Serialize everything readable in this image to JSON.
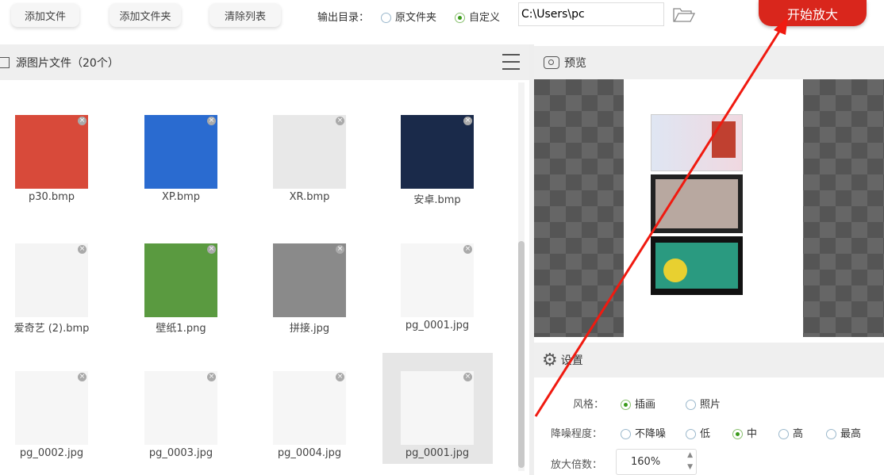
{
  "toolbar": {
    "add_file": "添加文件",
    "add_folder": "添加文件夹",
    "clear_list": "清除列表",
    "output_label": "输出目录：",
    "opt_source": "原文件夹",
    "opt_custom": "自定义",
    "output_path": "C:\\Users\\pc",
    "start": "开始放大"
  },
  "files": {
    "title": "源图片文件（20个）",
    "items": [
      {
        "name": "p30.bmp",
        "color": "#d84a3a"
      },
      {
        "name": "XP.bmp",
        "color": "#2a6bd0"
      },
      {
        "name": "XR.bmp",
        "color": "#e8e8e8"
      },
      {
        "name": "安卓.bmp",
        "color": "#1a2a4a"
      },
      {
        "name": "爱奇艺 (2).bmp",
        "color": "#f4f4f4"
      },
      {
        "name": "壁纸1.png",
        "color": "#5a9a40"
      },
      {
        "name": "拼接.jpg",
        "color": "#8a8a8a"
      },
      {
        "name": "pg_0001.jpg",
        "color": "#f6f6f6"
      },
      {
        "name": "pg_0002.jpg",
        "color": "#f6f6f6"
      },
      {
        "name": "pg_0003.jpg",
        "color": "#f6f6f6"
      },
      {
        "name": "pg_0004.jpg",
        "color": "#f6f6f6"
      },
      {
        "name": "pg_0001.jpg",
        "color": "#f6f6f6"
      }
    ]
  },
  "preview": {
    "title": "预览"
  },
  "settings": {
    "title": "设置",
    "style_label": "风格：",
    "style_opts": [
      "插画",
      "照片"
    ],
    "noise_label": "降噪程度：",
    "noise_opts": [
      "不降噪",
      "低",
      "中",
      "高",
      "最高"
    ],
    "scale_label": "放大倍数：",
    "scale_value": "160%"
  },
  "colors": {
    "accent": "#d9261c",
    "selected_radio": "#3a9a1a"
  }
}
